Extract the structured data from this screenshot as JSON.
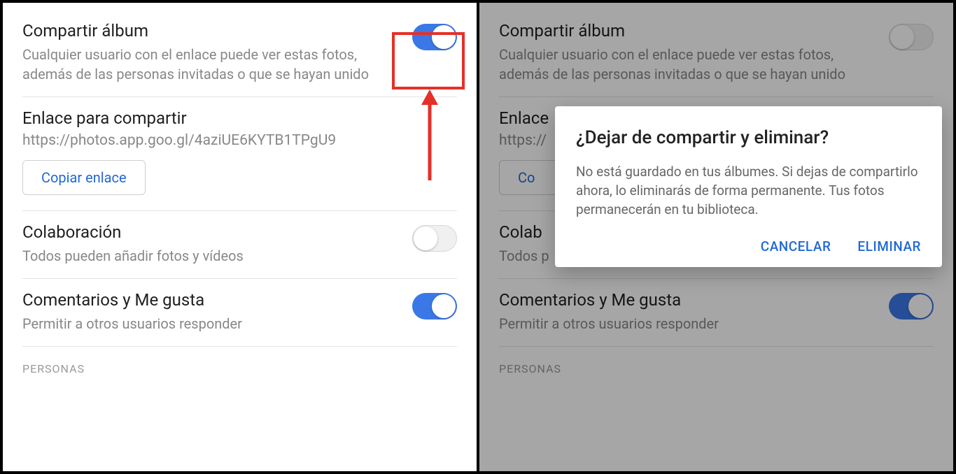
{
  "left": {
    "share": {
      "title": "Compartir álbum",
      "sub": "Cualquier usuario con el enlace puede ver estas fotos, además de las personas invitadas o que se hayan unido"
    },
    "link": {
      "title": "Enlace para compartir",
      "url": "https://photos.app.goo.gl/4aziUE6KYTB1TPgU9",
      "copy": "Copiar enlace"
    },
    "collab": {
      "title": "Colaboración",
      "sub": "Todos pueden añadir fotos y vídeos"
    },
    "comments": {
      "title": "Comentarios y Me gusta",
      "sub": "Permitir a otros usuarios responder"
    },
    "people_label": "PERSONAS"
  },
  "right": {
    "share": {
      "title": "Compartir álbum",
      "sub": "Cualquier usuario con el enlace puede ver estas fotos, además de las personas invitadas o que se hayan unido"
    },
    "link": {
      "title_truncated": "Enlace",
      "url_truncated": "https://",
      "copy_truncated": "Co"
    },
    "collab": {
      "title_truncated": "Colab",
      "sub_truncated": "Todos p"
    },
    "comments": {
      "title": "Comentarios y Me gusta",
      "sub": "Permitir a otros usuarios responder"
    },
    "people_label": "PERSONAS",
    "dialog": {
      "title": "¿Dejar de compartir y eliminar?",
      "body": "No está guardado en tus álbumes. Si dejas de compartirlo ahora, lo eliminarás de forma permanente. Tus fotos permanecerán en tu biblioteca.",
      "cancel": "CANCELAR",
      "delete": "ELIMINAR"
    }
  }
}
